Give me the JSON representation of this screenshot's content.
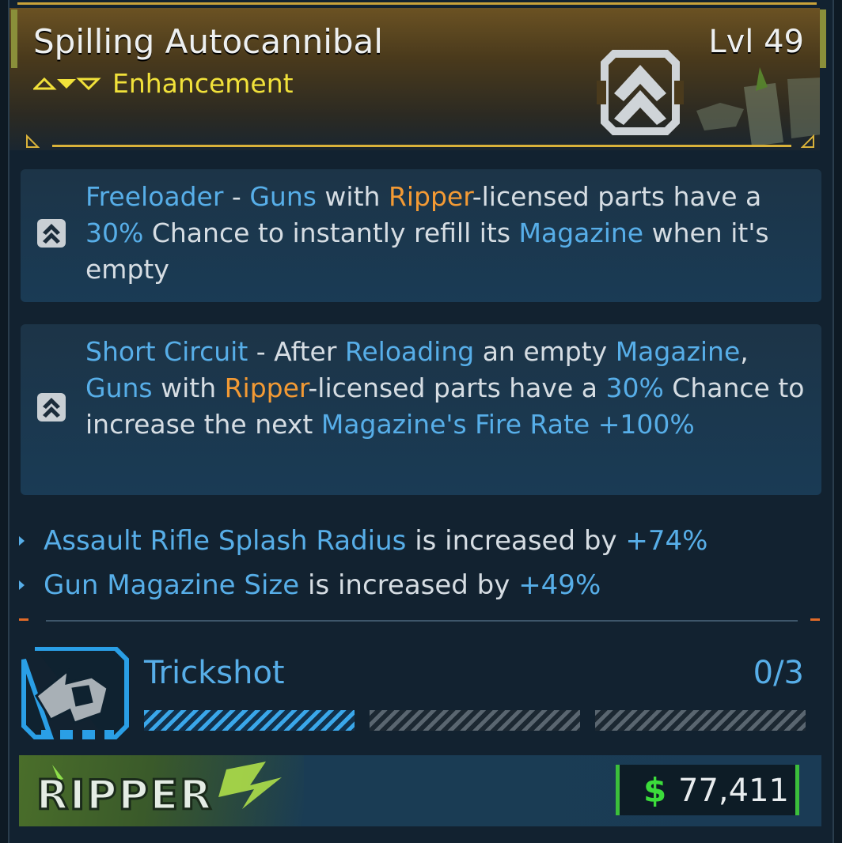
{
  "item": {
    "name": "Spilling Autocannibal",
    "rarity": "Enhancement",
    "level": "Lvl 49",
    "colors": {
      "rarity": "#f1e13a",
      "keyword": "#57aee8",
      "manufacturer": "#f39a34"
    }
  },
  "perks": [
    {
      "icon": "enhancement-chevron-icon",
      "segments": [
        {
          "text": "Freeloader",
          "style": "blue"
        },
        {
          "text": " - ",
          "style": "plain"
        },
        {
          "text": "Guns",
          "style": "blue"
        },
        {
          "text": " with ",
          "style": "plain"
        },
        {
          "text": "Ripper",
          "style": "orange"
        },
        {
          "text": "-licensed parts have a ",
          "style": "plain"
        },
        {
          "text": "30%",
          "style": "blue"
        },
        {
          "text": " Chance to instantly refill its ",
          "style": "plain"
        },
        {
          "text": "Magazine",
          "style": "blue"
        },
        {
          "text": " when it's empty",
          "style": "plain"
        }
      ]
    },
    {
      "icon": "enhancement-chevron-icon",
      "segments": [
        {
          "text": "Short Circuit",
          "style": "blue"
        },
        {
          "text": " - After ",
          "style": "plain"
        },
        {
          "text": "Reloading",
          "style": "blue"
        },
        {
          "text": " an empty ",
          "style": "plain"
        },
        {
          "text": "Magazine",
          "style": "blue"
        },
        {
          "text": ", ",
          "style": "plain"
        },
        {
          "text": "Guns",
          "style": "blue"
        },
        {
          "text": " with ",
          "style": "plain"
        },
        {
          "text": "Ripper",
          "style": "orange"
        },
        {
          "text": "-licensed parts have a ",
          "style": "plain"
        },
        {
          "text": "30%",
          "style": "blue"
        },
        {
          "text": " Chance to increase the next ",
          "style": "plain"
        },
        {
          "text": "Magazine's Fire Rate +100%",
          "style": "blue"
        }
      ]
    }
  ],
  "stats": [
    {
      "name": "Assault Rifle Splash Radius",
      "text": " is increased by ",
      "value": "+74%"
    },
    {
      "name": "Gun Magazine Size",
      "text": " is increased by ",
      "value": "+49%"
    }
  ],
  "skill": {
    "name": "Trickshot",
    "progress_label": "0/3",
    "progress_segments_filled": 1,
    "progress_segments_total": 3,
    "icon": "trickshot-skill-icon"
  },
  "footer": {
    "brand": "RIPPER",
    "currency_icon": "$",
    "price": "77,411"
  }
}
